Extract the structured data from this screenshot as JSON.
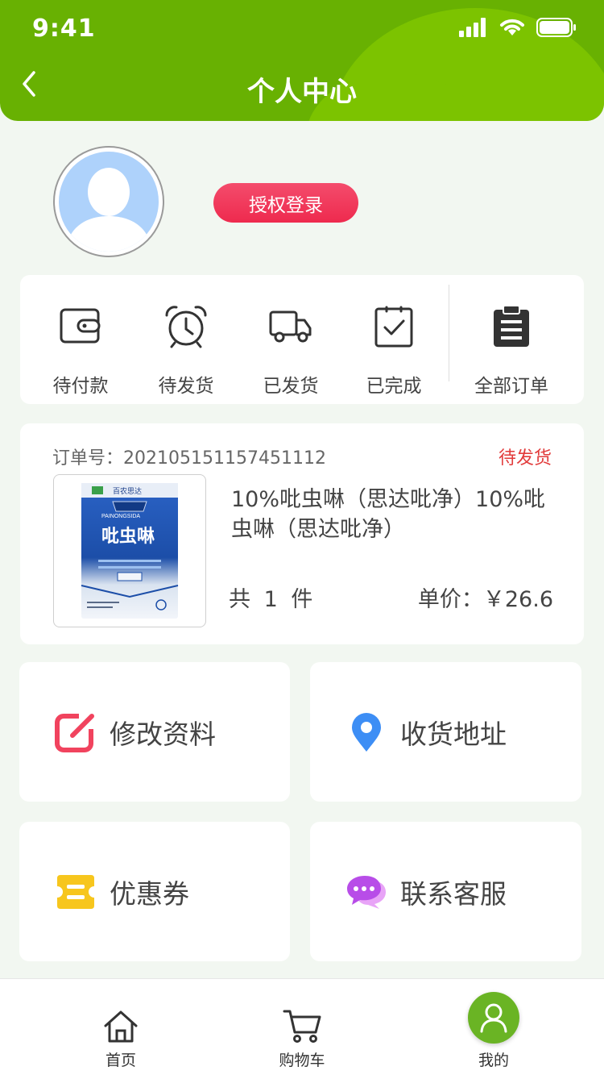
{
  "status_bar": {
    "time": "9:41"
  },
  "header": {
    "title": "个人中心"
  },
  "profile": {
    "login_label": "授权登录"
  },
  "order_bar": {
    "items": [
      {
        "label": "待付款",
        "icon": "wallet-icon"
      },
      {
        "label": "待发货",
        "icon": "alarm-clock-icon"
      },
      {
        "label": "已发货",
        "icon": "truck-icon"
      },
      {
        "label": "已完成",
        "icon": "clipboard-check-icon"
      },
      {
        "label": "全部订单",
        "icon": "clipboard-list-icon"
      }
    ]
  },
  "order": {
    "number_label": "订单号：",
    "number": "202105151157451112",
    "status": "待发货",
    "product_name": "10%吡虫啉（思达吡净）10%吡虫啉（思达吡净）",
    "quantity": "共 1 件",
    "price": "单价：￥26.6",
    "package": {
      "brand": "百农思达",
      "name": "吡虫啉",
      "en": "PAINONGSIDA"
    }
  },
  "menus": [
    {
      "label": "修改资料",
      "icon": "edit-icon",
      "color": "#f1435e"
    },
    {
      "label": "收货地址",
      "icon": "location-pin-icon",
      "color": "#3d8ef5"
    },
    {
      "label": "优惠券",
      "icon": "coupon-icon",
      "color": "#f7c61d"
    },
    {
      "label": "联系客服",
      "icon": "chat-bubbles-icon",
      "color": "#b84de8"
    }
  ],
  "tabbar": {
    "items": [
      {
        "label": "首页",
        "icon": "home-icon"
      },
      {
        "label": "购物车",
        "icon": "cart-icon"
      },
      {
        "label": "我的",
        "icon": "user-icon"
      }
    ]
  },
  "colors": {
    "primary_green": "#68b102",
    "accent_red": "#ee2a4e",
    "status_red": "#e23b3b"
  }
}
